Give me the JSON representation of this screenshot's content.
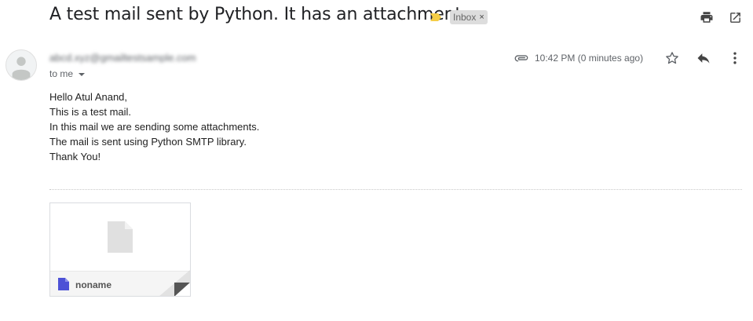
{
  "email": {
    "subject": "A test mail sent by Python. It has an attachment.",
    "label": "Inbox",
    "sender_blurred": "abcd.xyz@gmailtestsample.com",
    "recipient_text": "to me",
    "timestamp": "10:42 PM (0 minutes ago)",
    "body_lines": [
      "Hello Atul Anand,",
      "This is a test mail.",
      "In this mail we are sending some attachments.",
      "The mail is sent using Python SMTP library.",
      "Thank You!"
    ]
  },
  "attachment": {
    "name": "noname"
  },
  "icons": {
    "importance": "importance-marker-icon",
    "print": "print-icon",
    "open_new_window": "open-in-new-window-icon",
    "attachment": "paperclip-icon",
    "star": "star-icon",
    "reply": "reply-icon",
    "more": "more-vert-icon"
  },
  "colors": {
    "importance": "#f4cd46",
    "label_bg": "#dddddd",
    "doc_icon": "#4d51d6"
  }
}
